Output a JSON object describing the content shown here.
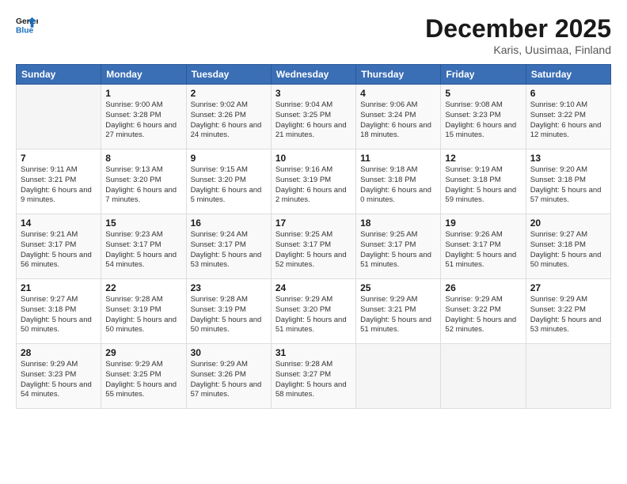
{
  "logo": {
    "line1": "General",
    "line2": "Blue"
  },
  "title": "December 2025",
  "subtitle": "Karis, Uusimaa, Finland",
  "days_of_week": [
    "Sunday",
    "Monday",
    "Tuesday",
    "Wednesday",
    "Thursday",
    "Friday",
    "Saturday"
  ],
  "weeks": [
    [
      {
        "day": "",
        "info": ""
      },
      {
        "day": "1",
        "info": "Sunrise: 9:00 AM\nSunset: 3:28 PM\nDaylight: 6 hours\nand 27 minutes."
      },
      {
        "day": "2",
        "info": "Sunrise: 9:02 AM\nSunset: 3:26 PM\nDaylight: 6 hours\nand 24 minutes."
      },
      {
        "day": "3",
        "info": "Sunrise: 9:04 AM\nSunset: 3:25 PM\nDaylight: 6 hours\nand 21 minutes."
      },
      {
        "day": "4",
        "info": "Sunrise: 9:06 AM\nSunset: 3:24 PM\nDaylight: 6 hours\nand 18 minutes."
      },
      {
        "day": "5",
        "info": "Sunrise: 9:08 AM\nSunset: 3:23 PM\nDaylight: 6 hours\nand 15 minutes."
      },
      {
        "day": "6",
        "info": "Sunrise: 9:10 AM\nSunset: 3:22 PM\nDaylight: 6 hours\nand 12 minutes."
      }
    ],
    [
      {
        "day": "7",
        "info": "Sunrise: 9:11 AM\nSunset: 3:21 PM\nDaylight: 6 hours\nand 9 minutes."
      },
      {
        "day": "8",
        "info": "Sunrise: 9:13 AM\nSunset: 3:20 PM\nDaylight: 6 hours\nand 7 minutes."
      },
      {
        "day": "9",
        "info": "Sunrise: 9:15 AM\nSunset: 3:20 PM\nDaylight: 6 hours\nand 5 minutes."
      },
      {
        "day": "10",
        "info": "Sunrise: 9:16 AM\nSunset: 3:19 PM\nDaylight: 6 hours\nand 2 minutes."
      },
      {
        "day": "11",
        "info": "Sunrise: 9:18 AM\nSunset: 3:18 PM\nDaylight: 6 hours\nand 0 minutes."
      },
      {
        "day": "12",
        "info": "Sunrise: 9:19 AM\nSunset: 3:18 PM\nDaylight: 5 hours\nand 59 minutes."
      },
      {
        "day": "13",
        "info": "Sunrise: 9:20 AM\nSunset: 3:18 PM\nDaylight: 5 hours\nand 57 minutes."
      }
    ],
    [
      {
        "day": "14",
        "info": "Sunrise: 9:21 AM\nSunset: 3:17 PM\nDaylight: 5 hours\nand 56 minutes."
      },
      {
        "day": "15",
        "info": "Sunrise: 9:23 AM\nSunset: 3:17 PM\nDaylight: 5 hours\nand 54 minutes."
      },
      {
        "day": "16",
        "info": "Sunrise: 9:24 AM\nSunset: 3:17 PM\nDaylight: 5 hours\nand 53 minutes."
      },
      {
        "day": "17",
        "info": "Sunrise: 9:25 AM\nSunset: 3:17 PM\nDaylight: 5 hours\nand 52 minutes."
      },
      {
        "day": "18",
        "info": "Sunrise: 9:25 AM\nSunset: 3:17 PM\nDaylight: 5 hours\nand 51 minutes."
      },
      {
        "day": "19",
        "info": "Sunrise: 9:26 AM\nSunset: 3:17 PM\nDaylight: 5 hours\nand 51 minutes."
      },
      {
        "day": "20",
        "info": "Sunrise: 9:27 AM\nSunset: 3:18 PM\nDaylight: 5 hours\nand 50 minutes."
      }
    ],
    [
      {
        "day": "21",
        "info": "Sunrise: 9:27 AM\nSunset: 3:18 PM\nDaylight: 5 hours\nand 50 minutes."
      },
      {
        "day": "22",
        "info": "Sunrise: 9:28 AM\nSunset: 3:19 PM\nDaylight: 5 hours\nand 50 minutes."
      },
      {
        "day": "23",
        "info": "Sunrise: 9:28 AM\nSunset: 3:19 PM\nDaylight: 5 hours\nand 50 minutes."
      },
      {
        "day": "24",
        "info": "Sunrise: 9:29 AM\nSunset: 3:20 PM\nDaylight: 5 hours\nand 51 minutes."
      },
      {
        "day": "25",
        "info": "Sunrise: 9:29 AM\nSunset: 3:21 PM\nDaylight: 5 hours\nand 51 minutes."
      },
      {
        "day": "26",
        "info": "Sunrise: 9:29 AM\nSunset: 3:22 PM\nDaylight: 5 hours\nand 52 minutes."
      },
      {
        "day": "27",
        "info": "Sunrise: 9:29 AM\nSunset: 3:22 PM\nDaylight: 5 hours\nand 53 minutes."
      }
    ],
    [
      {
        "day": "28",
        "info": "Sunrise: 9:29 AM\nSunset: 3:23 PM\nDaylight: 5 hours\nand 54 minutes."
      },
      {
        "day": "29",
        "info": "Sunrise: 9:29 AM\nSunset: 3:25 PM\nDaylight: 5 hours\nand 55 minutes."
      },
      {
        "day": "30",
        "info": "Sunrise: 9:29 AM\nSunset: 3:26 PM\nDaylight: 5 hours\nand 57 minutes."
      },
      {
        "day": "31",
        "info": "Sunrise: 9:28 AM\nSunset: 3:27 PM\nDaylight: 5 hours\nand 58 minutes."
      },
      {
        "day": "",
        "info": ""
      },
      {
        "day": "",
        "info": ""
      },
      {
        "day": "",
        "info": ""
      }
    ]
  ]
}
